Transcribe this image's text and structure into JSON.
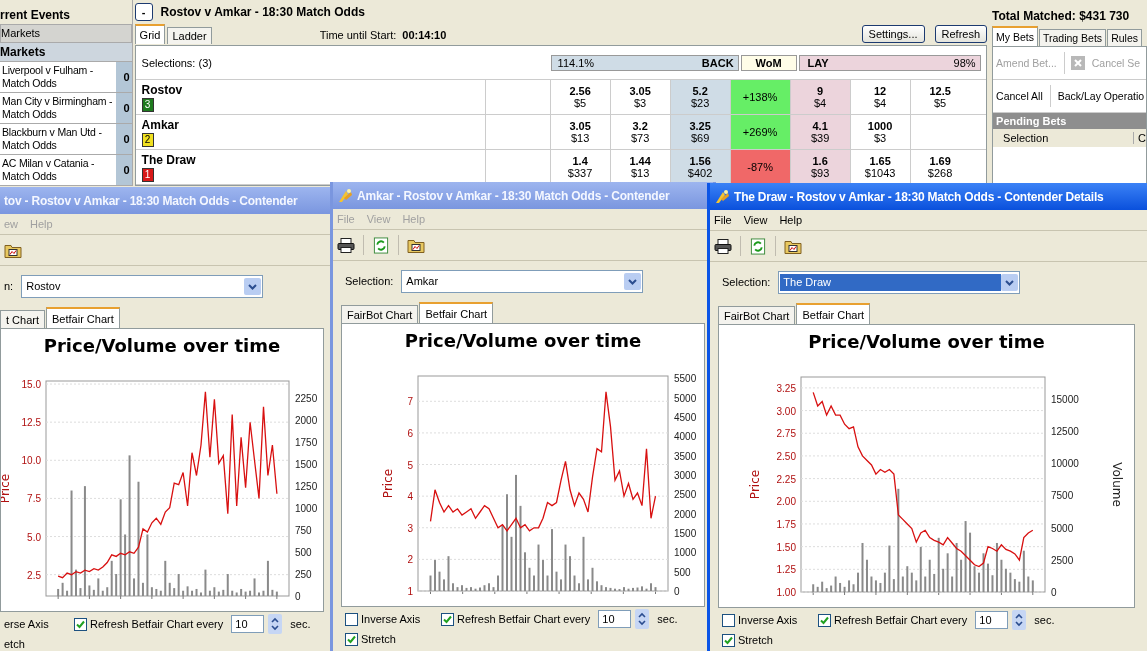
{
  "events_panel": {
    "title": "rrent Events",
    "section": "Markets",
    "subsection": "Markets",
    "items": [
      {
        "name": "Liverpool v Fulham - Match Odds",
        "count": "0"
      },
      {
        "name": "Man City v Birmingham - Match Odds",
        "count": "0"
      },
      {
        "name": "Blackburn v Man Utd - Match Odds",
        "count": "0"
      },
      {
        "name": "AC Milan v Catania - Match Odds",
        "count": "0"
      }
    ]
  },
  "market": {
    "collapse": "-",
    "title": "Rostov v Amkar - 18:30 Match Odds",
    "tabs": [
      {
        "label": "Grid",
        "selected": true
      },
      {
        "label": "Ladder",
        "selected": false
      }
    ],
    "time_label": "Time until Start:",
    "time": "00:14:10",
    "buttons": [
      "Settings...",
      "Refresh"
    ],
    "selections_label": "Selections: (3)",
    "back_percent": "114.1%",
    "back_label": "BACK",
    "wom_label": "WoM",
    "lay_label": "LAY",
    "lay_percent": "98%",
    "runners": [
      {
        "name": "Rostov",
        "number": "3",
        "color": "#1e7a1e",
        "back": [
          {
            "price": "2.56",
            "amount": "$5"
          },
          {
            "price": "3.05",
            "amount": "$3"
          },
          {
            "price": "5.2",
            "amount": "$23"
          }
        ],
        "wom": "+138%",
        "wom_positive": true,
        "lay": [
          {
            "price": "9",
            "amount": "$4"
          },
          {
            "price": "12",
            "amount": "$4"
          },
          {
            "price": "12.5",
            "amount": "$5"
          }
        ]
      },
      {
        "name": "Amkar",
        "number": "2",
        "color": "#f0e020",
        "back": [
          {
            "price": "3.05",
            "amount": "$13"
          },
          {
            "price": "3.2",
            "amount": "$73"
          },
          {
            "price": "3.25",
            "amount": "$69"
          }
        ],
        "wom": "+269%",
        "wom_positive": true,
        "lay": [
          {
            "price": "4.1",
            "amount": "$39"
          },
          {
            "price": "1000",
            "amount": "$3"
          }
        ]
      },
      {
        "name": "The Draw",
        "number": "1",
        "color": "#d81818",
        "back": [
          {
            "price": "1.4",
            "amount": "$337"
          },
          {
            "price": "1.44",
            "amount": "$13"
          },
          {
            "price": "1.56",
            "amount": "$402"
          }
        ],
        "wom": "-87%",
        "wom_positive": false,
        "lay": [
          {
            "price": "1.6",
            "amount": "$93"
          },
          {
            "price": "1.65",
            "amount": "$1043"
          },
          {
            "price": "1.69",
            "amount": "$268"
          }
        ]
      }
    ]
  },
  "bets_panel": {
    "total": "Total Matched: $431 730",
    "tabs": [
      {
        "label": "My Bets",
        "selected": true
      },
      {
        "label": "Trading Bets",
        "selected": false
      },
      {
        "label": "Rules",
        "selected": false
      }
    ],
    "actions": [
      {
        "label": "Amend Bet...",
        "disabled": true,
        "kind": "text"
      },
      {
        "label": "Cancel Se",
        "disabled": true,
        "kind": "cancel"
      }
    ],
    "actions_2": [
      "Cancel All",
      "Back/Lay Operatio"
    ],
    "section": "Pending Bets",
    "columns": [
      "Selection",
      "C"
    ]
  },
  "windows": [
    {
      "title": "tov - Rostov v Amkar - 18:30 Match Odds - Contender",
      "active": false,
      "menu": [
        "ew",
        "Help"
      ],
      "selection_label": "n:",
      "selection": "Rostov",
      "selection_highlighted": false,
      "tabs": [
        {
          "label": "t Chart",
          "selected": false
        },
        {
          "label": "Betfair Chart",
          "selected": true
        }
      ],
      "chart_data": {
        "type": "line",
        "title": "Price/Volume over time",
        "ylabel": "Price",
        "ylim": [
          1.1,
          15.2
        ],
        "grid": true,
        "yticks": [
          {
            "value": 15,
            "label": "15.0"
          },
          {
            "value": 12.5,
            "label": "12.5"
          },
          {
            "value": 10,
            "label": "10.0"
          },
          {
            "value": 7.5,
            "label": "7.5"
          },
          {
            "value": 5,
            "label": "5.0"
          },
          {
            "value": 2.5,
            "label": "2.5"
          }
        ],
        "y2lim": [
          0,
          2446
        ],
        "y2ticks": [
          2250,
          2000,
          1750,
          1500,
          1250,
          1000,
          750,
          500,
          250,
          0
        ],
        "series": [
          {
            "type": "bar",
            "axis": "y2",
            "color": "#8a8a8a",
            "values": [
              80,
              150,
              60,
              1200,
              300,
              90,
              1250,
              120,
              70,
              200,
              60,
              100,
              400,
              250,
              1100,
              700,
              1600,
              200,
              1300,
              150,
              700,
              100,
              80,
              60,
              400,
              150,
              90,
              250,
              60,
              110,
              60,
              80,
              40,
              300,
              60,
              100,
              50,
              70,
              250,
              60,
              40,
              80,
              50,
              60,
              200,
              40,
              60,
              400,
              70,
              50
            ]
          },
          {
            "color": "#d81010",
            "values": [
              2.4,
              2.3,
              2.6,
              2.5,
              2.7,
              2.6,
              2.8,
              2.7,
              2.9,
              2.8,
              3.0,
              3.3,
              3.8,
              3.7,
              3.9,
              3.8,
              4.0,
              3.9,
              4.3,
              5.5,
              5.3,
              5.9,
              6.2,
              5.8,
              6.6,
              6.9,
              8.5,
              8.4,
              9.2,
              7.0,
              10.5,
              9.0,
              11.0,
              14.5,
              10.2,
              14.0,
              9.8,
              10.3,
              6.5,
              13.0,
              7.0,
              11.5,
              8.2,
              12.5,
              10.0,
              7.5,
              13.5,
              9.0,
              11.0,
              7.8
            ]
          }
        ]
      },
      "options": [
        {
          "label": "erse Axis"
        },
        {
          "label": "etch"
        }
      ],
      "refresh": {
        "label": "Refresh Betfair Chart every",
        "checked": true
      },
      "interval": "10",
      "unit": "sec."
    },
    {
      "title": "Amkar - Rostov v Amkar - 18:30 Match Odds - Contender",
      "active": false,
      "menu": [
        "File",
        "View",
        "Help"
      ],
      "selection_label": "Selection:",
      "selection": "Amkar",
      "selection_highlighted": false,
      "tabs": [
        {
          "label": "FairBot Chart",
          "selected": false
        },
        {
          "label": "Betfair Chart",
          "selected": true
        }
      ],
      "chart_data": {
        "type": "line",
        "title": "Price/Volume over time",
        "ylabel": "Price",
        "ylim": [
          1,
          7.8
        ],
        "grid": true,
        "yticks": [
          7,
          6,
          5,
          4,
          3,
          2,
          1
        ],
        "y2lim": [
          0,
          5556
        ],
        "y2ticks": [
          5500,
          5000,
          4500,
          4000,
          3500,
          3000,
          2500,
          2000,
          1500,
          1000,
          500,
          0
        ],
        "series": [
          {
            "type": "bar",
            "axis": "y2",
            "color": "#8a8a8a",
            "values": [
              400,
              800,
              500,
              300,
              900,
              200,
              100,
              150,
              80,
              100,
              60,
              90,
              150,
              200,
              100,
              400,
              1700,
              2500,
              1400,
              3000,
              2200,
              1000,
              600,
              400,
              1200,
              800,
              400,
              1600,
              500,
              300,
              1200,
              900,
              400,
              200,
              1400,
              300,
              600,
              250,
              150,
              100,
              80,
              60,
              50,
              100,
              60,
              80,
              90,
              120,
              60,
              200,
              100
            ]
          },
          {
            "color": "#d81010",
            "values": [
              3.2,
              4.2,
              3.8,
              3.5,
              3.7,
              3.5,
              3.6,
              3.4,
              3.5,
              3.6,
              3.3,
              3.5,
              3.7,
              3.6,
              3.3,
              3.0,
              3.1,
              2.9,
              3.1,
              3.3,
              3.0,
              3.1,
              2.9,
              3.0,
              3.0,
              3.3,
              3.8,
              3.7,
              3.8,
              4.5,
              5.1,
              4.2,
              3.7,
              4.1,
              3.9,
              3.5,
              4.6,
              5.5,
              5.4,
              7.3,
              6.2,
              4.5,
              4.8,
              4.0,
              4.4,
              3.9,
              4.1,
              3.7,
              5.5,
              3.3,
              4.0
            ]
          }
        ]
      },
      "options": [
        {
          "label": "Inverse Axis",
          "checked": false
        },
        {
          "label": "Stretch",
          "checked": true
        }
      ],
      "refresh": {
        "label": "Refresh Betfair Chart every",
        "checked": true
      },
      "interval": "10",
      "unit": "sec."
    },
    {
      "title": "The Draw - Rostov v Amkar - 18:30 Match Odds - Contender Details",
      "active": true,
      "menu": [
        "File",
        "View",
        "Help"
      ],
      "selection_label": "Selection:",
      "selection": "The Draw",
      "selection_highlighted": true,
      "tabs": [
        {
          "label": "FairBot Chart",
          "selected": false
        },
        {
          "label": "Betfair Chart",
          "selected": true
        }
      ],
      "chart_data": {
        "type": "line",
        "title": "Price/Volume over time",
        "ylabel": "Price",
        "ylim": [
          1,
          3.37
        ],
        "grid": true,
        "yticks": [
          {
            "value": 3.25,
            "label": "3.25"
          },
          {
            "value": 3,
            "label": "3.00"
          },
          {
            "value": 2.75,
            "label": "2.75"
          },
          {
            "value": 2.5,
            "label": "2.50"
          },
          {
            "value": 2.25,
            "label": "2.25"
          },
          {
            "value": 2,
            "label": "2.00"
          },
          {
            "value": 1.75,
            "label": "1.75"
          },
          {
            "value": 1.5,
            "label": "1.50"
          },
          {
            "value": 1.25,
            "label": "1.25"
          },
          {
            "value": 1,
            "label": "1.00"
          }
        ],
        "y2label": "Volume",
        "y2lim": [
          0,
          16667
        ],
        "y2ticks": [
          15000,
          12500,
          10000,
          7500,
          5000,
          2500,
          0
        ],
        "series": [
          {
            "type": "bar",
            "axis": "y2",
            "color": "#8a8a8a",
            "values": [
              600,
              400,
              800,
              300,
              500,
              1200,
              700,
              400,
              900,
              600,
              1500,
              3800,
              2500,
              1200,
              900,
              700,
              1500,
              3600,
              1000,
              8000,
              1200,
              2000,
              1500,
              900,
              3500,
              1200,
              2500,
              1400,
              4200,
              1800,
              3000,
              1200,
              3800,
              2500,
              5500,
              4600,
              2000,
              1500,
              3000,
              2200,
              1300,
              3800,
              2500,
              1800,
              1500,
              1000,
              800,
              3200,
              1200,
              900
            ]
          },
          {
            "color": "#d81010",
            "values": [
              3.2,
              3.05,
              3.1,
              2.95,
              3.05,
              2.95,
              2.95,
              2.85,
              2.8,
              2.82,
              2.6,
              2.5,
              2.45,
              2.4,
              2.3,
              2.35,
              2.32,
              2.35,
              2.3,
              1.85,
              1.8,
              1.75,
              1.7,
              1.55,
              1.65,
              1.68,
              1.6,
              1.57,
              1.55,
              1.52,
              1.6,
              1.54,
              1.48,
              1.45,
              1.4,
              1.35,
              1.3,
              1.28,
              1.32,
              1.5,
              1.48,
              1.45,
              1.52,
              1.47,
              1.45,
              1.42,
              1.35,
              1.6,
              1.65,
              1.68
            ]
          }
        ]
      },
      "options": [
        {
          "label": "Inverse Axis",
          "checked": false
        },
        {
          "label": "Stretch",
          "checked": true
        }
      ],
      "refresh": {
        "label": "Refresh Betfair Chart every",
        "checked": true
      },
      "interval": "10",
      "unit": "sec."
    }
  ]
}
